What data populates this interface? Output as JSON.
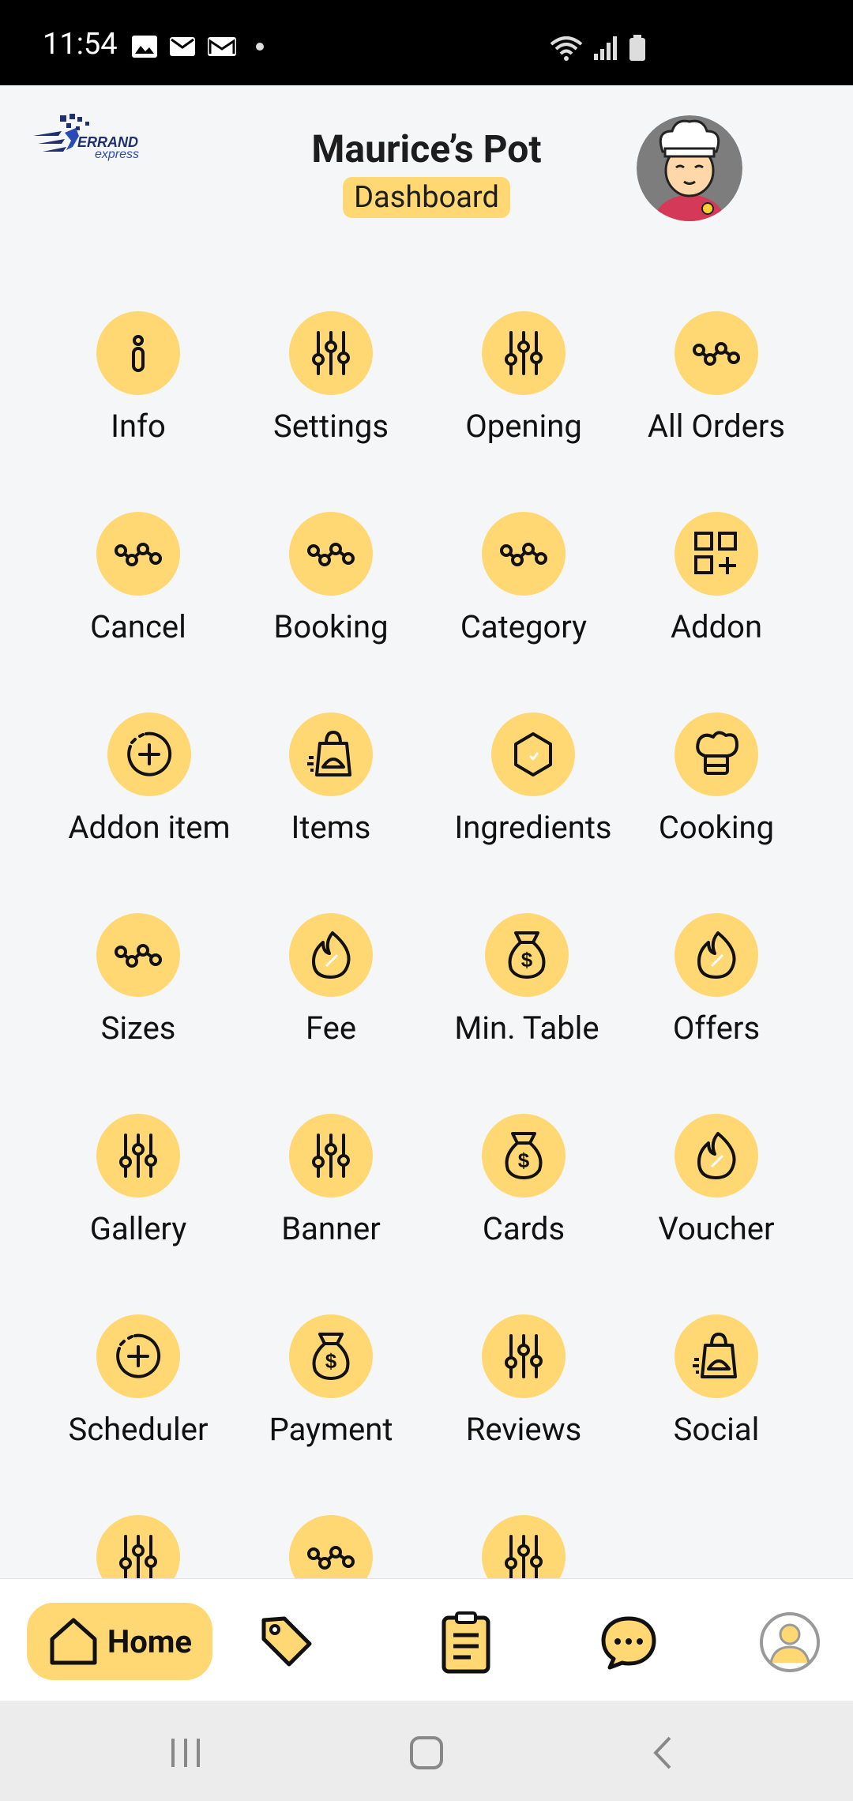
{
  "status_bar": {
    "time": "11:54"
  },
  "header": {
    "title": "Maurice’s Pot",
    "subtitle": "Dashboard"
  },
  "grid": {
    "items": [
      {
        "label": "Info",
        "icon": "info-icon"
      },
      {
        "label": "Settings",
        "icon": "sliders-icon"
      },
      {
        "label": "Opening",
        "icon": "sliders-icon"
      },
      {
        "label": "All Orders",
        "icon": "nodes-icon"
      },
      {
        "label": "Cancel",
        "icon": "nodes-icon"
      },
      {
        "label": "Booking",
        "icon": "nodes-icon"
      },
      {
        "label": "Category",
        "icon": "nodes-icon"
      },
      {
        "label": "Addon",
        "icon": "grid-add-icon"
      },
      {
        "label": "Addon item",
        "icon": "plus-circle-icon"
      },
      {
        "label": "Items",
        "icon": "food-bag-icon"
      },
      {
        "label": "Ingredients",
        "icon": "hexagon-check-icon"
      },
      {
        "label": "Cooking",
        "icon": "chef-hat-icon"
      },
      {
        "label": "Sizes",
        "icon": "nodes-icon"
      },
      {
        "label": "Fee",
        "icon": "flame-icon"
      },
      {
        "label": "Min. Table",
        "icon": "money-bag-icon"
      },
      {
        "label": "Offers",
        "icon": "flame-icon"
      },
      {
        "label": "Gallery",
        "icon": "sliders-icon"
      },
      {
        "label": "Banner",
        "icon": "sliders-icon"
      },
      {
        "label": "Cards",
        "icon": "money-bag-icon"
      },
      {
        "label": "Voucher",
        "icon": "flame-icon"
      },
      {
        "label": "Scheduler",
        "icon": "plus-circle-icon"
      },
      {
        "label": "Payment",
        "icon": "money-bag-icon"
      },
      {
        "label": "Reviews",
        "icon": "sliders-icon"
      },
      {
        "label": "Social",
        "icon": "food-bag-icon"
      },
      {
        "label": "",
        "icon": "sliders-icon"
      },
      {
        "label": "",
        "icon": "nodes-icon"
      },
      {
        "label": "",
        "icon": "sliders-icon"
      }
    ]
  },
  "bottom_nav": {
    "home_label": "Home"
  },
  "colors": {
    "accent": "#ffd873",
    "background": "#f5f6f8"
  }
}
